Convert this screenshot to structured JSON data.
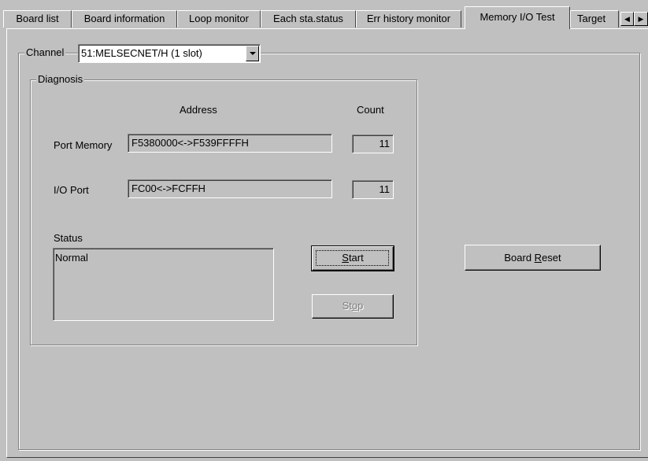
{
  "tabs": [
    {
      "label": "Board list",
      "active": false
    },
    {
      "label": "Board information",
      "active": false
    },
    {
      "label": "Loop monitor",
      "active": false
    },
    {
      "label": "Each sta.status",
      "active": false
    },
    {
      "label": "Err history monitor",
      "active": false
    },
    {
      "label": "Memory I/O Test",
      "active": true
    },
    {
      "label": "Target",
      "active": false
    }
  ],
  "tab_scroll": {
    "left_icon": "arrow-left",
    "right_icon": "arrow-right"
  },
  "channel": {
    "label": "Channel",
    "selected": "51:MELSECNET/H (1 slot)"
  },
  "diagnosis": {
    "title": "Diagnosis",
    "address_header": "Address",
    "count_header": "Count",
    "port_memory": {
      "label": "Port Memory",
      "address": "F5380000<->F539FFFFH",
      "count": "11"
    },
    "io_port": {
      "label": "I/O Port",
      "address": "FC00<->FCFFH",
      "count": "11"
    },
    "status_label": "Status",
    "status_value": "Normal",
    "start_button": {
      "mnemonic": "S",
      "rest": "tart",
      "enabled": true
    },
    "stop_button": {
      "pre": "St",
      "mnemonic": "o",
      "rest": "p",
      "enabled": false
    }
  },
  "board_reset": {
    "pre": "Board ",
    "mnemonic": "R",
    "rest": "eset"
  },
  "colors": {
    "face": "#c0c0c0",
    "shadow": "#808080",
    "highlight": "#ffffff",
    "disabled_text": "#808080"
  }
}
